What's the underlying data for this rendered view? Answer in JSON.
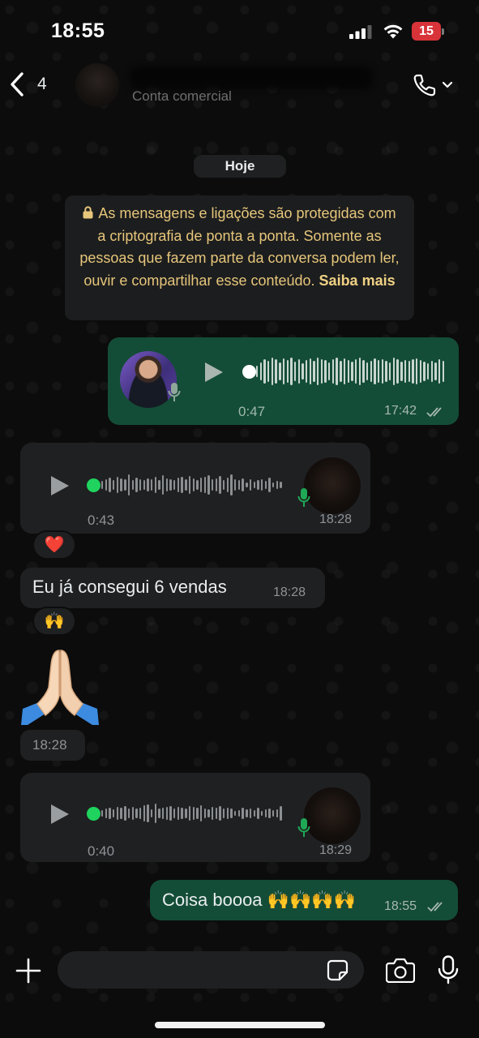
{
  "status_bar": {
    "time": "18:55",
    "battery": "15"
  },
  "header": {
    "back_count": "4",
    "subtitle": "Conta comercial"
  },
  "chat": {
    "date_chip": "Hoje",
    "encryption_notice": {
      "text": "As mensagens e ligações são protegidas com a criptografia de ponta a ponta. Somente as pessoas que fazem parte da conversa podem ler, ouvir e compartilhar esse conteúdo.",
      "link": "Saiba mais"
    },
    "messages": [
      {
        "kind": "voice",
        "direction": "outgoing",
        "duration": "0:47",
        "time": "17:42",
        "status": "read"
      },
      {
        "kind": "voice",
        "direction": "incoming",
        "duration": "0:43",
        "time": "18:28",
        "reaction": "❤️"
      },
      {
        "kind": "text",
        "direction": "incoming",
        "text": "Eu já consegui 6 vendas",
        "time": "18:28",
        "reaction": "🙌"
      },
      {
        "kind": "emoji",
        "direction": "incoming",
        "emoji": "🙏",
        "time": "18:28"
      },
      {
        "kind": "voice",
        "direction": "incoming",
        "duration": "0:40",
        "time": "18:29"
      },
      {
        "kind": "text",
        "direction": "outgoing",
        "text": "Coisa boooa 🙌🙌🙌🙌",
        "time": "18:55",
        "status": "read"
      }
    ]
  },
  "composer": {
    "placeholder": ""
  },
  "colors": {
    "outgoing_bubble": "#144d37",
    "incoming_bubble": "#1f2022",
    "notice_text": "#e6c67b",
    "unplayed_dot": "#1fd35e"
  },
  "icons": [
    "back-chevron",
    "voice-call",
    "play",
    "microphone",
    "plus",
    "sticker",
    "camera",
    "double-check",
    "lock"
  ]
}
